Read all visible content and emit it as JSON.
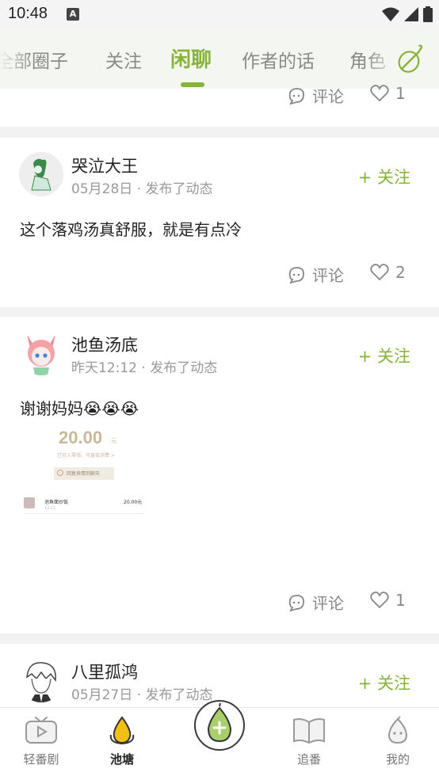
{
  "status_bar": {
    "time": "10:48",
    "notif_glyph": "A"
  },
  "tabs": [
    {
      "label": "全部圈子"
    },
    {
      "label": "关注"
    },
    {
      "label": "闲聊"
    },
    {
      "label": "作者的话"
    },
    {
      "label": "角色"
    }
  ],
  "active_tab": "闲聊",
  "accent_color": "#86b338",
  "top_partial": {
    "comment_label": "评论",
    "like_count": "1"
  },
  "posts": [
    {
      "author": "哭泣大王",
      "meta": "05月28日 · 发布了动态",
      "follow_label": "+ 关注",
      "content": "这个落鸡汤真舒服，就是有点冷",
      "comment_label": "评论",
      "like_count": "2"
    },
    {
      "author": "池鱼汤底",
      "meta": "昨天12:12 · 发布了动态",
      "follow_label": "+ 关注",
      "content": "谢谢妈妈😭😭😭",
      "comment_label": "评论",
      "like_count": "1",
      "image": {
        "amount": "20.00",
        "amount_unit": "元",
        "sub_text": "已存入零钱，可直接消费 >",
        "reply_button": "回复表情到聊天",
        "row_name": "池鱼面炒饭",
        "row_time": "12:11",
        "row_amount": "20.00元"
      }
    },
    {
      "author": "八里孤鸿",
      "meta": "05月27日 · 发布了动态",
      "follow_label": "+ 关注"
    }
  ],
  "bottom_nav": [
    {
      "label": "轻番剧",
      "icon": "tv-icon"
    },
    {
      "label": "池塘",
      "icon": "pond-icon"
    },
    {
      "label": "",
      "icon": "add-pear-icon"
    },
    {
      "label": "追番",
      "icon": "book-icon"
    },
    {
      "label": "我的",
      "icon": "pear-face-icon"
    }
  ]
}
